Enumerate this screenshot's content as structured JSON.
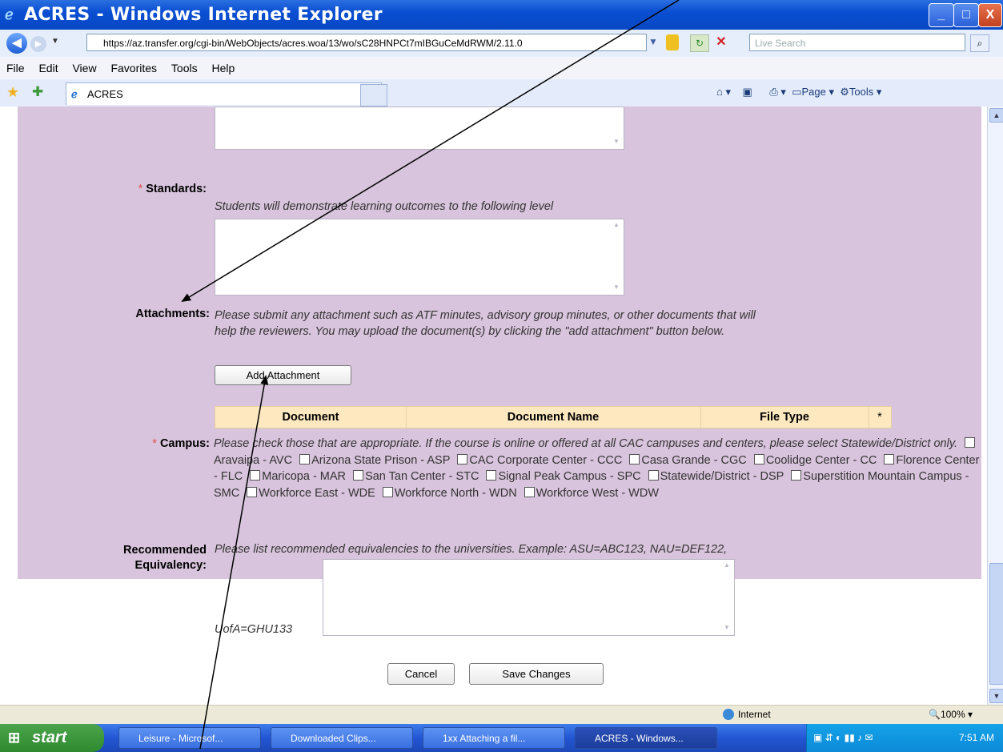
{
  "window": {
    "title": "ACRES - Windows Internet Explorer",
    "minimize": "_",
    "maximize": "□",
    "close": "X"
  },
  "addressbar": {
    "url": "https://az.transfer.org/cgi-bin/WebObjects/acres.woa/13/wo/sC28HNPCt7mIBGuCeMdRWM/2.11.0",
    "search_placeholder": "Live Search"
  },
  "menu": [
    "File",
    "Edit",
    "View",
    "Favorites",
    "Tools",
    "Help"
  ],
  "tab": {
    "title": "ACRES"
  },
  "toolbar_right": {
    "page": "Page",
    "tools": "Tools"
  },
  "form": {
    "standards": {
      "label": "Standards:",
      "required": "*",
      "instruction": "Students will demonstrate learning outcomes to the following level"
    },
    "attachments": {
      "label": "Attachments:",
      "instruction_line1": "Please submit any attachment such as ATF minutes, advisory group minutes, or other documents that will",
      "instruction_line2": "help the reviewers. You may upload the document(s) by clicking the \"add attachment\" button below.",
      "add_button": "Add Attachment",
      "table_headers": [
        "Document",
        "Document Name",
        "File Type",
        "*"
      ]
    },
    "campus": {
      "label": "Campus:",
      "required": "*",
      "instruction": "Please check those that are appropriate. If the course is online or offered at all CAC campuses and centers, please select Statewide/District only.",
      "options": [
        "Aravaipa - AVC",
        "Arizona State Prison - ASP",
        "CAC Corporate Center - CCC",
        "Casa Grande - CGC",
        "Coolidge Center - CC",
        "Florence Center - FLC",
        "Maricopa - MAR",
        "San Tan Center - STC",
        "Signal Peak Campus - SPC",
        "Statewide/District - DSP",
        "Superstition Mountain Campus - SMC",
        "Workforce East - WDE",
        "Workforce North - WDN",
        "Workforce West - WDW"
      ]
    },
    "equivalency": {
      "label_line1": "Recommended",
      "label_line2": "Equivalency:",
      "instruction": "Please list recommended equivalencies to the universities. Example: ASU=ABC123, NAU=DEF122,",
      "example_tail": "UofA=GHU133"
    },
    "cancel_button": "Cancel",
    "save_button": "Save Changes"
  },
  "statusbar": {
    "zone": "Internet",
    "zoom": "100%"
  },
  "taskbar": {
    "start": "start",
    "tasks": [
      "Leisure - Microsof...",
      "Downloaded Clips...",
      "1xx Attaching a fil...",
      "ACRES - Windows..."
    ],
    "clock": "7:51 AM"
  }
}
